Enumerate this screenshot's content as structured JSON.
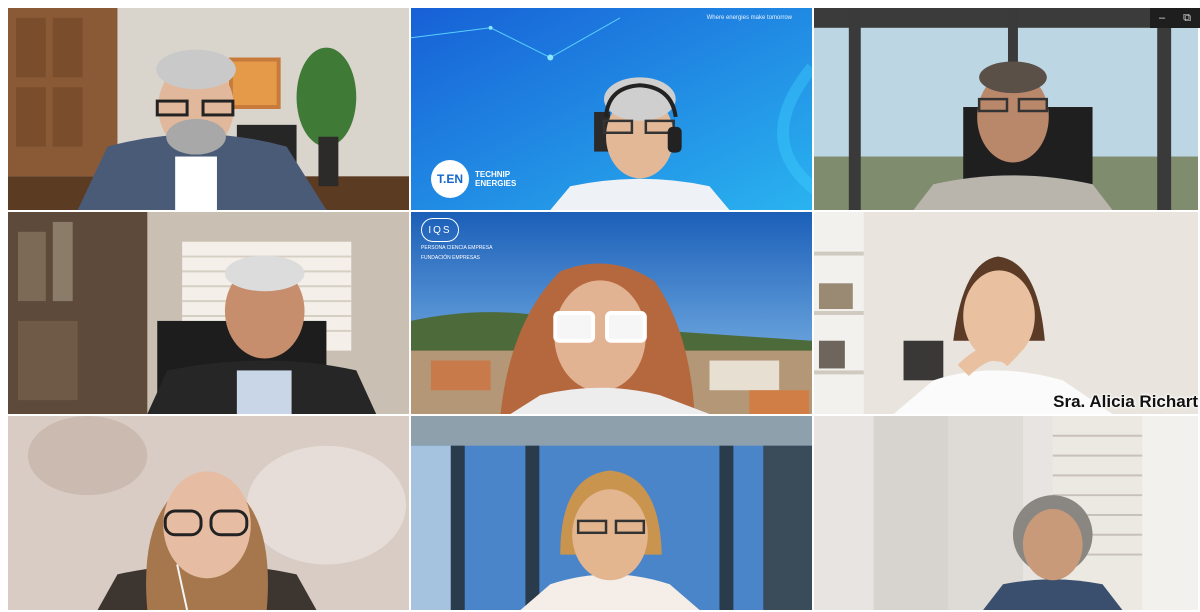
{
  "window": {
    "minimize_glyph": "–",
    "maximize_glyph": "⧉"
  },
  "participants": [
    {
      "id": "p1",
      "background": "office-wood"
    },
    {
      "id": "p2",
      "background": "technip-energies"
    },
    {
      "id": "p3",
      "background": "window-view"
    },
    {
      "id": "p4",
      "background": "home-blinds"
    },
    {
      "id": "p5",
      "background": "iqs-campus"
    },
    {
      "id": "p6",
      "background": "shelves",
      "name": "Sra. Alicia Richart"
    },
    {
      "id": "p7",
      "background": "blurred-wall"
    },
    {
      "id": "p8",
      "background": "window-frames"
    },
    {
      "id": "p9",
      "background": "cabinets"
    }
  ],
  "branding": {
    "ten_logo": "T.EN",
    "ten_words_line1": "TECHNIP",
    "ten_words_line2": "ENERGIES",
    "ten_tagline": "Where energies make tomorrow",
    "iqs_logo": "IQS",
    "iqs_line1": "PERSONA CIENCIA EMPRESA",
    "iqs_line2": "FUNDACIÓN EMPRESAS"
  },
  "colors": {
    "technip_blue": "#1a6fe0",
    "iqs_sky": "#2e7fd1"
  }
}
